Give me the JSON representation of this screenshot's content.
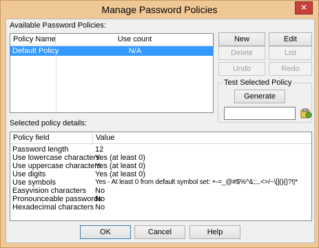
{
  "window": {
    "title": "Manage Password Policies",
    "close_glyph": "✕"
  },
  "available": {
    "label": "Available Password Policies:",
    "columns": [
      "Policy Name",
      "Use count"
    ],
    "rows": [
      {
        "name": "Default Policy",
        "count": "N/A",
        "selected": true
      }
    ]
  },
  "buttons": {
    "new": "New",
    "edit": "Edit",
    "delete": "Delete",
    "list": "List",
    "undo": "Undo",
    "redo": "Redo"
  },
  "test": {
    "group_label": "Test Selected Policy",
    "generate": "Generate",
    "output_value": ""
  },
  "details": {
    "label": "Selected policy details:",
    "columns": [
      "Policy field",
      "Value"
    ],
    "rows": [
      {
        "field": "Password length",
        "value": "12"
      },
      {
        "field": "Use lowercase characters",
        "value": "Yes (at least 0)"
      },
      {
        "field": "Use uppercase characters",
        "value": "Yes (at least 0)"
      },
      {
        "field": "Use digits",
        "value": "Yes (at least 0)"
      },
      {
        "field": "Use symbols",
        "value": "Yes - At least 0 from default symbol set: +-=_@#$%^&;:,.<>/~\\[](){}?!|*"
      },
      {
        "field": "Easyvision characters",
        "value": "No"
      },
      {
        "field": "Pronounceable passwords",
        "value": "No"
      },
      {
        "field": "Hexadecimal characters",
        "value": "No"
      }
    ]
  },
  "footer": {
    "ok": "OK",
    "cancel": "Cancel",
    "help": "Help"
  },
  "colors": {
    "title_bar": "#f0c896",
    "close_button": "#c7413a",
    "selection": "#3399ff"
  }
}
